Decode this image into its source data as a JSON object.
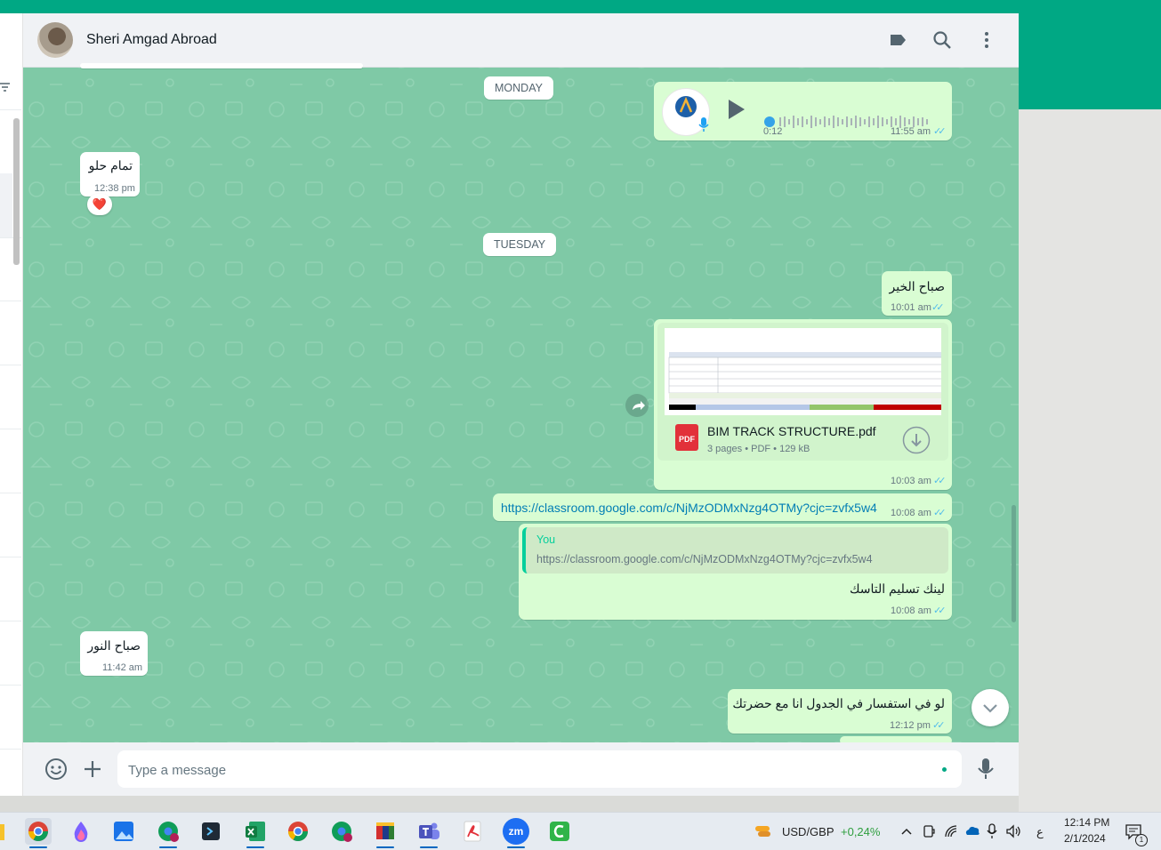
{
  "window": {
    "contact_name": "Sheri Amgad Abroad",
    "header_icons": [
      "label-icon",
      "search-icon",
      "more-vertical-icon"
    ]
  },
  "date_chips": {
    "monday": "MONDAY",
    "tuesday": "TUESDAY"
  },
  "messages": {
    "voice": {
      "duration": "0:12",
      "time": "11:55 am",
      "avatar_text": "RADIANT GROUP"
    },
    "in1": {
      "text": "تمام حلو",
      "time": "12:38 pm",
      "reaction": "❤️"
    },
    "out1": {
      "text": "صباح الخير",
      "time": "10:01 am"
    },
    "doc": {
      "filename": "BIM TRACK STRUCTURE.pdf",
      "meta": "3 pages • PDF • 129 kB",
      "badge": "PDF",
      "time": "10:03 am"
    },
    "link": {
      "url": "https://classroom.google.com/c/NjMzODMxNzg4OTMy?cjc=zvfx5w4",
      "time": "10:08 am"
    },
    "reply": {
      "quoted_author": "You",
      "quoted_text": "https://classroom.google.com/c/NjMzODMxNzg4OTMy?cjc=zvfx5w4",
      "text": "لينك تسليم التاسك",
      "time": "10:08 am"
    },
    "in2": {
      "text": "صباح النور",
      "time": "11:42 am"
    },
    "out2": {
      "text": "لو في استفسار في الجدول انا مع حضرتك",
      "time": "12:12 pm"
    }
  },
  "composer": {
    "placeholder": "Type a message"
  },
  "colors": {
    "brand": "#00a884",
    "chat_bg": "#7fc9a6",
    "outgoing_bubble": "#d9fdd3",
    "read_ticks": "#53bdeb"
  },
  "taskbar": {
    "apps": [
      "chrome-icon",
      "paint-drop-icon",
      "photos-icon",
      "chrome-work-icon",
      "terminal-icon",
      "excel-icon",
      "chrome-icon",
      "chrome-work-icon",
      "archive-icon",
      "teams-icon",
      "acrobat-icon",
      "zoom-icon",
      "camtasia-icon"
    ],
    "currency_pair": "USD/GBP",
    "currency_change": "+0,24%",
    "lang": "ع",
    "clock_time": "12:14 PM",
    "clock_date": "2/1/2024",
    "notification_count": "1"
  }
}
